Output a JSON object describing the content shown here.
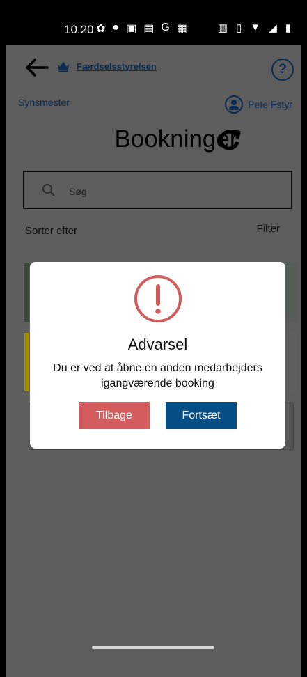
{
  "status_bar": {
    "time": "10.20",
    "left_icons": [
      "settings-icon",
      "facebook-icon",
      "vpn-icon",
      "signal-icon",
      "google-icon",
      "image-icon"
    ],
    "right_icons": [
      "volte-icon",
      "vibrate-icon",
      "wifi-icon",
      "cell-icon",
      "battery-icon"
    ]
  },
  "header": {
    "agency": "Færdselsstyrelsen",
    "role": "Synsmester",
    "user_name": "Pete Fstyr"
  },
  "main": {
    "title": "Bookninger",
    "search_placeholder": "Søg",
    "sort_label": "Sorter efter",
    "filter_label": "Filter"
  },
  "dialog": {
    "title": "Advarsel",
    "message": "Du er ved at åbne en anden medarbejders igangværende booking",
    "back_label": "Tilbage",
    "continue_label": "Fortsæt",
    "colors": {
      "warning": "#d35d5d",
      "primary": "#064e86"
    }
  }
}
